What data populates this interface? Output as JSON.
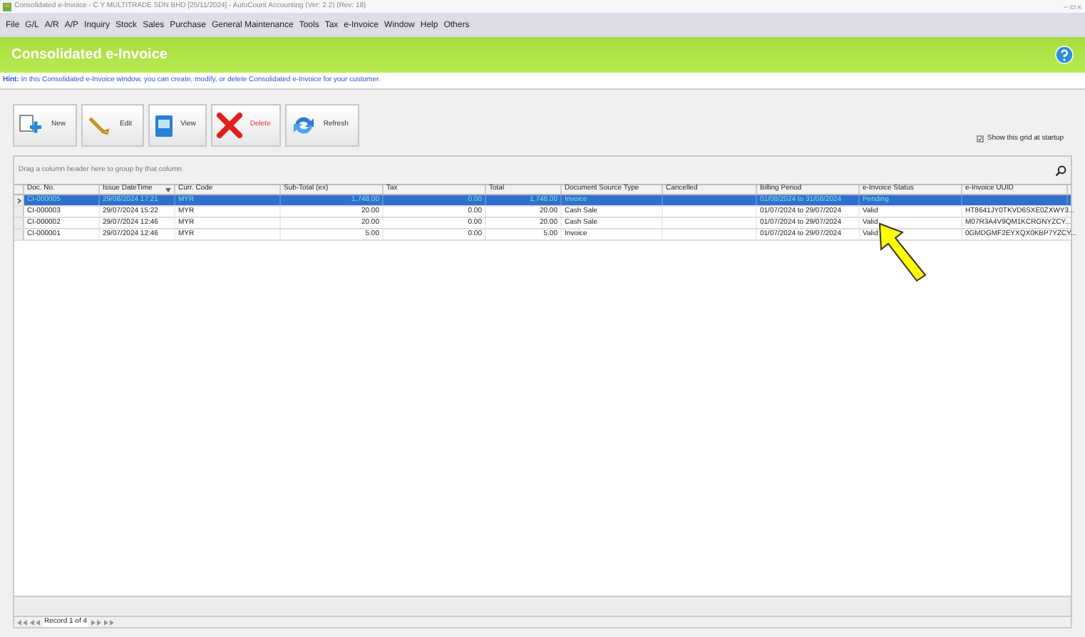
{
  "window": {
    "title": "Consolidated e-Invoice - C Y MULTITRADE SDN BHD [25/11/2024] - AutoCount Accounting (Ver: 2.2) (Rev: 18)"
  },
  "menu": [
    "File",
    "G/L",
    "A/R",
    "A/P",
    "Inquiry",
    "Stock",
    "Sales",
    "Purchase",
    "General Maintenance",
    "Tools",
    "Tax",
    "e-Invoice",
    "Window",
    "Help",
    "Others"
  ],
  "header": {
    "title": "Consolidated e-Invoice"
  },
  "hint": {
    "label": "Hint:",
    "text": "In this Consolidated e-Invoice window, you can create, modify, or delete Consolidated e-Invoice for your customer."
  },
  "toolbar": [
    {
      "kind": "new",
      "label": "New"
    },
    {
      "kind": "edit",
      "label": "Edit"
    },
    {
      "kind": "view",
      "label": "View"
    },
    {
      "kind": "delete",
      "label": "Delete"
    },
    {
      "kind": "refresh",
      "label": "Refresh"
    }
  ],
  "show_grid": {
    "label": "Show this grid at startup",
    "checked": true
  },
  "group_hint": "Drag a column header here to group by that column",
  "table": {
    "columns": [
      "Doc. No.",
      "Issue DateTime",
      "Curr. Code",
      "Sub-Total (ex)",
      "Tax",
      "Total",
      "Document Source Type",
      "Cancelled",
      "Billing Period",
      "e-Invoice Status",
      "e-Invoice UUID"
    ],
    "rows": [
      {
        "selected": true,
        "cells": [
          "CI-000005",
          "29/08/2024 17:21",
          "MYR",
          "1,748.00",
          "0.00",
          "1,748.00",
          "Invoice",
          "",
          "01/08/2024 to 31/08/2024",
          "Pending",
          ""
        ]
      },
      {
        "selected": false,
        "cells": [
          "CI-000003",
          "29/07/2024 15:22",
          "MYR",
          "20.00",
          "0.00",
          "20.00",
          "Cash Sale",
          "",
          "01/07/2024 to 29/07/2024",
          "Valid",
          "HT8641JY0TKVD6SXE0ZXWY3..."
        ]
      },
      {
        "selected": false,
        "cells": [
          "CI-000002",
          "29/07/2024 12:46",
          "MYR",
          "20.00",
          "0.00",
          "20.00",
          "Cash Sale",
          "",
          "01/07/2024 to 29/07/2024",
          "Valid",
          "M07R3A4V9QM1KCRGNYZCY..."
        ]
      },
      {
        "selected": false,
        "cells": [
          "CI-000001",
          "29/07/2024 12:46",
          "MYR",
          "5.00",
          "0.00",
          "5.00",
          "Invoice",
          "",
          "01/07/2024 to 29/07/2024",
          "Valid",
          "0GMDGMF2EYXQX0KBP7YZCY..."
        ]
      }
    ]
  },
  "navigator": {
    "record": "Record 1 of 4"
  }
}
